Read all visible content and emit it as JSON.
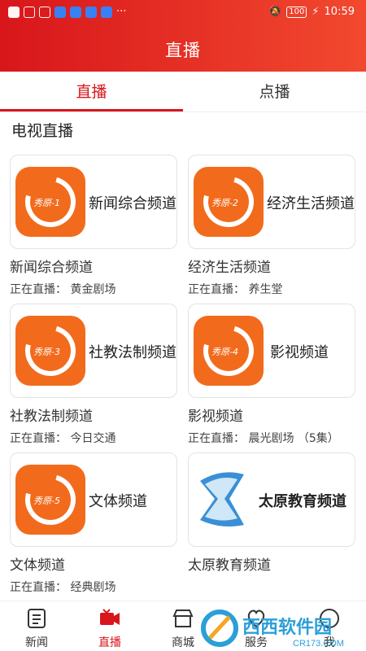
{
  "status_bar": {
    "time": "10:59",
    "battery": "100"
  },
  "header": {
    "title": "直播"
  },
  "tabs": [
    {
      "label": "直播",
      "active": true
    },
    {
      "label": "点播",
      "active": false
    }
  ],
  "section_title": "电视直播",
  "channels": [
    {
      "name": "新闻综合频道",
      "logo_text": "新闻综合频道",
      "logo_mark": "秀原-1",
      "now": "正在直播：  黄金剧场"
    },
    {
      "name": "经济生活频道",
      "logo_text": "经济生活频道",
      "logo_mark": "秀原-2",
      "now": "正在直播：  养生堂"
    },
    {
      "name": "社教法制频道",
      "logo_text": "社教法制频道",
      "logo_mark": "秀原-3",
      "now": "正在直播：  今日交通"
    },
    {
      "name": "影视频道",
      "logo_text": "影视频道",
      "logo_mark": "秀原-4",
      "now": "正在直播：  晨光剧场  （5集）"
    },
    {
      "name": "文体频道",
      "logo_text": "文体频道",
      "logo_mark": "秀原-5",
      "now": "正在直播：  经典剧场"
    },
    {
      "name": "太原教育频道",
      "logo_text": "太原教育频道",
      "logo_mark": "",
      "now": ""
    }
  ],
  "bottom_nav": [
    {
      "label": "新闻",
      "icon": "news-icon",
      "active": false
    },
    {
      "label": "直播",
      "icon": "live-camera-icon",
      "active": true
    },
    {
      "label": "商城",
      "icon": "shop-icon",
      "active": false
    },
    {
      "label": "服务",
      "icon": "service-icon",
      "active": false
    },
    {
      "label": "我",
      "icon": "profile-icon",
      "active": false
    }
  ],
  "watermark": {
    "text": "西西软件园",
    "sub": "CR173.COM"
  },
  "colors": {
    "accent": "#d8161b",
    "logo_orange": "#f26b1d"
  }
}
